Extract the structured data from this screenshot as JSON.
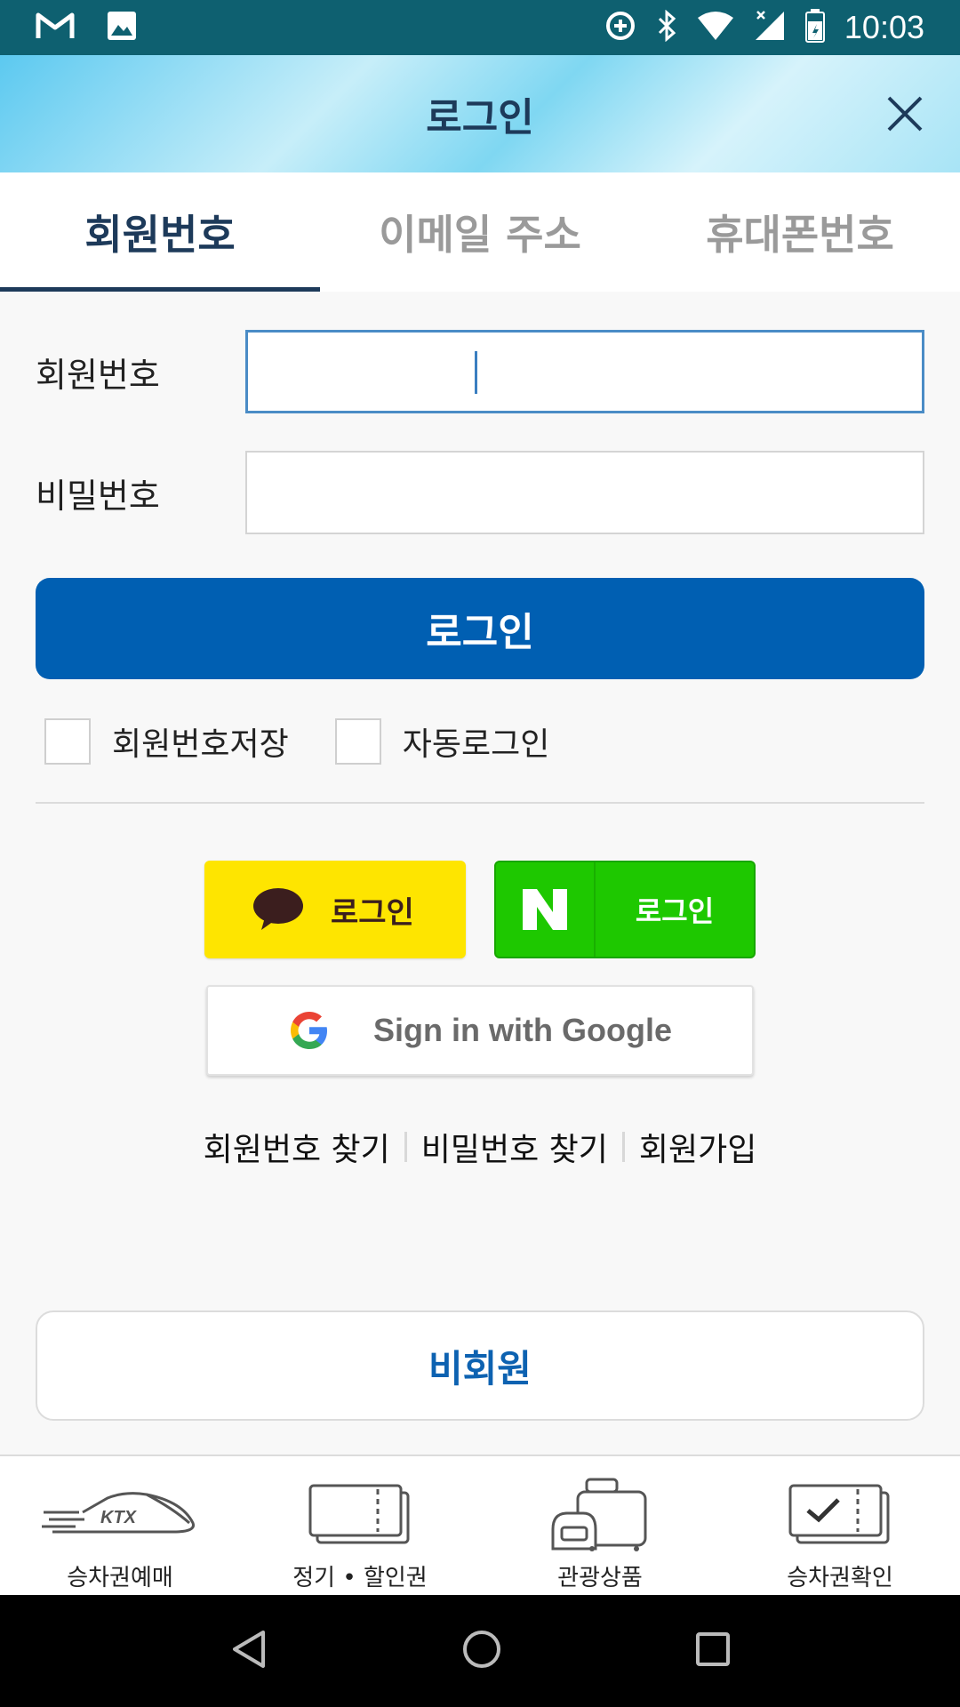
{
  "status_bar": {
    "time": "10:03"
  },
  "header": {
    "title": "로그인"
  },
  "tabs": [
    {
      "label": "회원번호",
      "active": true
    },
    {
      "label": "이메일 주소",
      "active": false
    },
    {
      "label": "휴대폰번호",
      "active": false
    }
  ],
  "form": {
    "member_no_label": "회원번호",
    "member_no_value": "",
    "password_label": "비밀번호",
    "password_value": ""
  },
  "login_button": "로그인",
  "checkboxes": {
    "save_member_no": {
      "label": "회원번호저장",
      "checked": false
    },
    "auto_login": {
      "label": "자동로그인",
      "checked": false
    }
  },
  "social": {
    "kakao_label": "로그인",
    "naver_label": "로그인",
    "google_label": "Sign in with Google"
  },
  "links": {
    "find_member_no": "회원번호 찾기",
    "find_password": "비밀번호 찾기",
    "sign_up": "회원가입"
  },
  "guest_button": "비회원",
  "bottom_nav": [
    {
      "label": "승차권예매",
      "icon": "ktx-train-icon"
    },
    {
      "label": "정기 • 할인권",
      "icon": "ticket-icon"
    },
    {
      "label": "관광상품",
      "icon": "luggage-icon"
    },
    {
      "label": "승차권확인",
      "icon": "ticket-check-icon"
    }
  ],
  "colors": {
    "primary": "#005fb2",
    "kakao": "#fee500",
    "naver": "#1ec800",
    "status_bar": "#0e6070"
  }
}
